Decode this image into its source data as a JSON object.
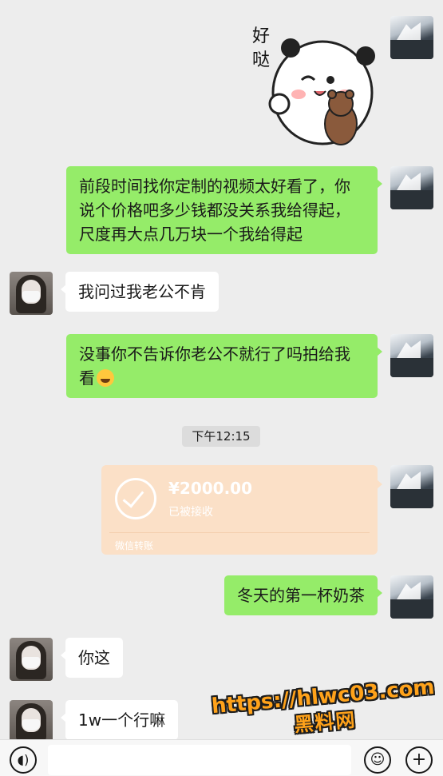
{
  "sticker": {
    "caption": "好哒"
  },
  "messages": [
    {
      "side": "me",
      "text": "前段时间找你定制的视频太好看了，你说个价格吧多少钱都没关系我给得起，尺度再大点几万块一个我给得起"
    },
    {
      "side": "her",
      "text": "我问过我老公不肯"
    },
    {
      "side": "me",
      "text": "没事你不告诉你老公不就行了吗拍给我看"
    },
    {
      "side": "me",
      "text": "冬天的第一杯奶茶"
    },
    {
      "side": "her",
      "text": "你这"
    },
    {
      "side": "her",
      "text": "1w一个行嘛"
    }
  ],
  "timestamp": "下午12:15",
  "transfer": {
    "amount": "¥2000.00",
    "status": "已被接收",
    "label": "微信转账"
  },
  "watermark": {
    "url": "https://hlwc03.com",
    "name": "黑料网"
  },
  "icons": {
    "voice": "voice-icon",
    "emoji": "emoji-icon",
    "plus": "plus-icon"
  },
  "colors": {
    "my_bubble": "#95ec69",
    "her_bubble": "#ffffff",
    "transfer_card": "#fbe0c7",
    "chat_bg": "#ededed"
  }
}
